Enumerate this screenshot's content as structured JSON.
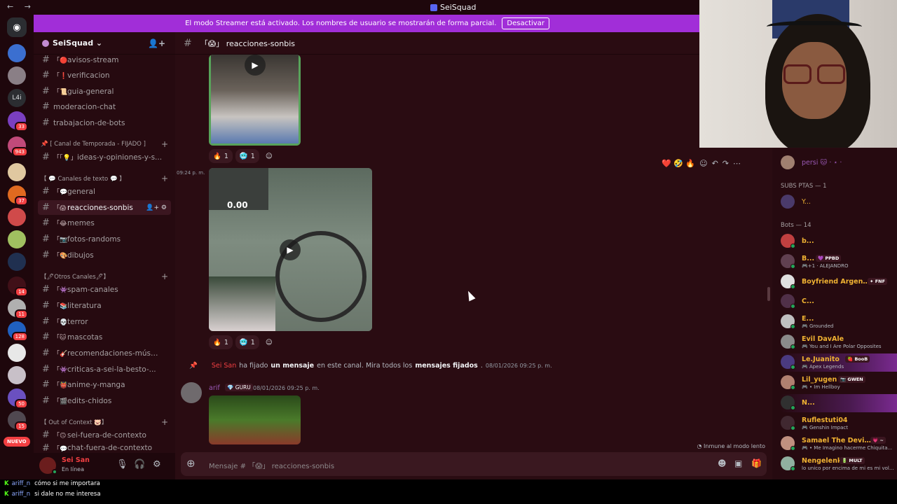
{
  "window": {
    "title": "SeiSquad",
    "nav": "← →"
  },
  "banner": {
    "text": "El modo Streamer está activado. Los nombres de usuario se mostrarán de forma parcial.",
    "button": "Desactivar"
  },
  "rail": {
    "home_icon": "discord-icon",
    "text_server": "L4i",
    "badges": [
      "33",
      "943",
      "37",
      "14",
      "11",
      "128",
      "50",
      "15"
    ],
    "new_label": "NUEVO"
  },
  "server": {
    "name": "SeiSquad ⌄",
    "invite_icon": "add-member-icon"
  },
  "channels": {
    "top": [
      {
        "emo": "「🔴",
        "label": "avisos-stream"
      },
      {
        "emo": "「❗",
        "label": "verificacion"
      },
      {
        "emo": "「📜",
        "label": "guia-general"
      },
      {
        "emo": "",
        "label": "moderacion-chat"
      },
      {
        "emo": "",
        "label": "trabajacion-de-bots"
      }
    ],
    "cat1": "📌 [ Canal de Temporada - FIJADO ]",
    "cat1_items": [
      {
        "emo": "「「💡」",
        "label": "ideas-y-opiniones-y-s..."
      }
    ],
    "cat2": "【 💬 Canales de texto 💬 】",
    "cat2_items": [
      {
        "emo": "「💬",
        "label": "general"
      },
      {
        "emo": "「😱",
        "label": "reacciones-sonbis",
        "active": true
      },
      {
        "emo": "「😂",
        "label": "memes"
      },
      {
        "emo": "「📷",
        "label": "fotos-randoms"
      },
      {
        "emo": "「🎨",
        "label": "dibujos"
      }
    ],
    "cat3": "【🖊Otros Canales🖊】",
    "cat3_items": [
      {
        "emo": "「👾",
        "label": "spam-canales"
      },
      {
        "emo": "「📚",
        "label": "literatura"
      },
      {
        "emo": "「💀",
        "label": "terror"
      },
      {
        "emo": "「🐱",
        "label": "mascotas"
      },
      {
        "emo": "「🎸",
        "label": "recomendaciones-músi..."
      },
      {
        "emo": "「👾",
        "label": "criticas-a-sei-la-besto-..."
      },
      {
        "emo": "「👹",
        "label": "anime-y-manga"
      },
      {
        "emo": "「🎬",
        "label": "edits-chidos"
      }
    ],
    "cat4": "【 Out of Context 🐷】",
    "cat4_items": [
      {
        "emo": "「🙃",
        "label": "sei-fuera-de-contexto"
      },
      {
        "emo": "「💬",
        "label": "chat-fuera-de-contexto"
      }
    ]
  },
  "user": {
    "name": "Sei San",
    "status": "En línea"
  },
  "header": {
    "channel": "「😱」 reacciones-sonbis"
  },
  "chat": {
    "reactions1": [
      {
        "emoji": "🔥",
        "count": "1"
      },
      {
        "emoji": "🥶",
        "count": "1"
      }
    ],
    "msg_time": "09:24 p. m.",
    "reactions2": [
      {
        "emoji": "🔥",
        "count": "1"
      },
      {
        "emoji": "🥶",
        "count": "1"
      }
    ],
    "tools": "❤️ 🤣 🔥",
    "pinned": {
      "user": "Sei San",
      "t1": "ha fijado",
      "t2": "un mensaje",
      "t3": "en este canal. Mira todos los",
      "t4": "mensajes fijados",
      "t5": ".",
      "ts": "08/01/2026 09:25 p. m."
    },
    "msg2": {
      "author": "arif",
      "tag": "💎 GURU",
      "ts": "08/01/2026 09:25 p. m."
    },
    "slow": "Inmune al modo lento",
    "video_text": "0.00"
  },
  "composer": {
    "placeholder": "Mensaje # 「😱」 reacciones-sonbis"
  },
  "members": {
    "top_name": "persi 🐱 · ⋆ ·",
    "group1": "SUBS PTAS — 1",
    "sub1": "Y...",
    "group2": "Bots — 14",
    "bots": [
      {
        "name": "b...",
        "color": "#f0b232"
      },
      {
        "name": "B...",
        "color": "#f0b232",
        "tag": "💜 PPBD",
        "act": "🎮+1 · ALEJANDRO"
      },
      {
        "name": "Boyfriend Argenti...",
        "color": "#f0b232",
        "tag": "✦ FNF"
      },
      {
        "name": "C...",
        "color": "#f0b232"
      },
      {
        "name": "E...",
        "color": "#f0b232",
        "act": "🎮 Grounded"
      },
      {
        "name": "Evil DavAle",
        "color": "#f0b232",
        "act": "🎮 You and I Are Polar Opposites"
      },
      {
        "name": "Le.Juanito",
        "color": "#f0b232",
        "tag": "🍓 BooB",
        "act": "🎮 Apex Legends",
        "hl": true
      },
      {
        "name": "Lil_yugen",
        "color": "#f0b232",
        "tag": "📷 GWEN",
        "act": "🎮 • Im Hellboy"
      },
      {
        "name": "N...",
        "color": "#f0b232",
        "hl": true
      },
      {
        "name": "Ruflestuti04",
        "color": "#f0b232",
        "act": "🎮 Genshin Impact"
      },
      {
        "name": "Samael The Devil ...",
        "color": "#f0b232",
        "tag": "💗 ~",
        "act": "🎮 • Me Imagino hacerme Chiquita..."
      },
      {
        "name": "Ñengelenkil",
        "color": "#f0b232",
        "tag": "🔋 MULT",
        "act": "lo unico por encima de mi es mi vol..."
      }
    ]
  },
  "overlay": [
    {
      "user": "ariff_n",
      "text": "cómo si me importara"
    },
    {
      "user": "ariff_n",
      "text": "si dale no me interesa"
    }
  ]
}
